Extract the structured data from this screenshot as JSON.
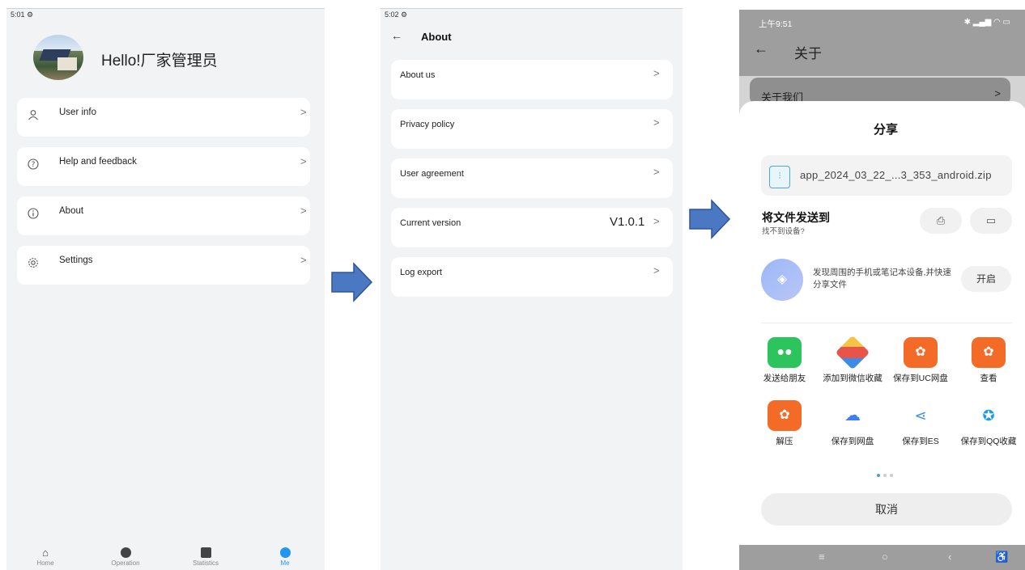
{
  "screen1": {
    "status_time": "5:01",
    "greeting": "Hello!厂家管理员",
    "menu": [
      {
        "label": "User info",
        "icon": "user-icon"
      },
      {
        "label": "Help and feedback",
        "icon": "help-icon"
      },
      {
        "label": "About",
        "icon": "info-icon"
      },
      {
        "label": "Settings",
        "icon": "gear-icon"
      }
    ],
    "bottom_nav": [
      {
        "label": "Home",
        "active": false
      },
      {
        "label": "Operation",
        "active": false
      },
      {
        "label": "Statistics",
        "active": false
      },
      {
        "label": "Me",
        "active": true
      }
    ],
    "active_color": "#2196f3"
  },
  "screen2": {
    "status_time": "5:02",
    "title": "About",
    "items": [
      {
        "label": "About us"
      },
      {
        "label": "Privacy policy"
      },
      {
        "label": "User agreement"
      },
      {
        "label": "Current version",
        "value": "V1.0.1"
      },
      {
        "label": "Log export"
      }
    ]
  },
  "arrow_color": "#4a78c2",
  "screen3": {
    "status_time": "上午9:51",
    "header_title": "关于",
    "peek_item": "关于我们",
    "share_title": "分享",
    "file_name": "app_2024_03_22_...3_353_android.zip",
    "send_to": "将文件发送到",
    "no_device": "找不到设备?",
    "discover_text": "发现周围的手机或笔记本设备,并快速分享文件",
    "open_label": "开启",
    "apps": [
      {
        "label": "发送给朋友",
        "icon": "wechat-icon",
        "color": "#2dc45d"
      },
      {
        "label": "添加到微信收藏",
        "icon": "cube-icon",
        "color": "#f0f0f0"
      },
      {
        "label": "保存到UC网盘",
        "icon": "uc-icon",
        "color": "#f46b27"
      },
      {
        "label": "查看",
        "icon": "uc-view-icon",
        "color": "#f46b27"
      },
      {
        "label": "解压",
        "icon": "uc-unzip-icon",
        "color": "#f46b27"
      },
      {
        "label": "保存到网盘",
        "icon": "baidu-cloud-icon",
        "color": "#ffffff"
      },
      {
        "label": "保存到ES",
        "icon": "es-share-icon",
        "color": "#ffffff"
      },
      {
        "label": "保存到QQ收藏",
        "icon": "qq-fav-icon",
        "color": "#ffffff"
      }
    ],
    "cancel_label": "取消"
  }
}
